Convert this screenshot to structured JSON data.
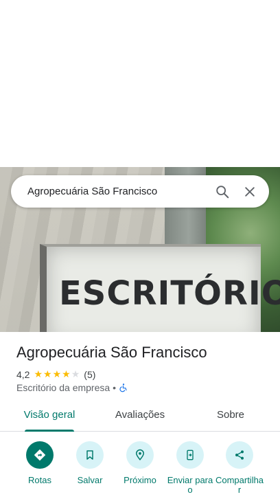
{
  "search": {
    "query": "Agropecuária São Francisco"
  },
  "photo": {
    "sign_text": "ESCRITÓRIO"
  },
  "place": {
    "name": "Agropecuária São Francisco",
    "rating": "4,2",
    "rating_value": 4.2,
    "review_count": "(5)",
    "category": "Escritório da empresa",
    "separator": "•"
  },
  "tabs": [
    {
      "label": "Visão geral",
      "active": true
    },
    {
      "label": "Avaliações",
      "active": false
    },
    {
      "label": "Sobre",
      "active": false
    }
  ],
  "actions": [
    {
      "label": "Rotas",
      "icon": "directions-icon"
    },
    {
      "label": "Salvar",
      "icon": "bookmark-icon"
    },
    {
      "label": "Próximo",
      "icon": "nearby-icon"
    },
    {
      "label": "Enviar para o",
      "icon": "send-to-phone-icon"
    },
    {
      "label": "Compartilhar",
      "icon": "share-icon"
    }
  ],
  "colors": {
    "accent": "#00796b",
    "star": "#fbbc04",
    "action_bg": "#d7f3f7"
  }
}
